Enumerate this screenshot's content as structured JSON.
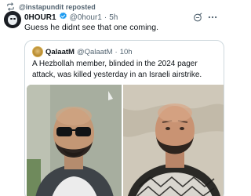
{
  "repost": {
    "text": "@instapundit reposted"
  },
  "post": {
    "author_name": "0HOUR1",
    "handle": "@0hour1",
    "separator": "·",
    "time": "5h",
    "text": "Guess he didnt see that one coming."
  },
  "quote": {
    "author_name": "QalaatM",
    "handle": "@QalaatM",
    "separator": "·",
    "time": "10h",
    "text": "A Hezbollah member, blinded in the 2024 pager attack, was killed yesterday in an Israeli airstrike."
  },
  "icons": {
    "repost": "repost-icon",
    "verified": "verified-badge-icon",
    "grok": "grok-icon",
    "more": "more-icon"
  },
  "colors": {
    "text": "#0f1419",
    "muted": "#536471",
    "verified": "#1d9bf0",
    "border": "#cfd9de"
  }
}
